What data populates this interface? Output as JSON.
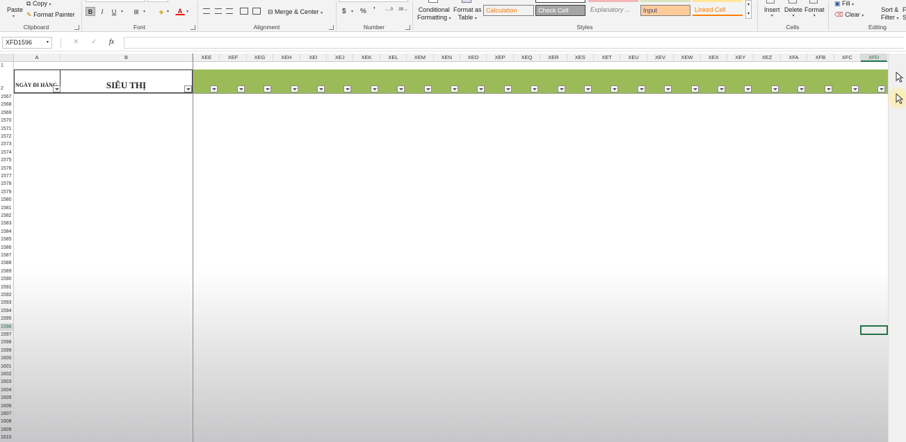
{
  "ribbon": {
    "clipboard": {
      "label": "Clipboard",
      "paste": "Paste",
      "copy": "Copy",
      "format_painter": "Format Painter"
    },
    "font": {
      "label": "Font",
      "bold": "B",
      "italic": "I",
      "underline": "U",
      "font_color": "A"
    },
    "alignment": {
      "label": "Alignment",
      "merge_center": "Merge & Center"
    },
    "number": {
      "label": "Number",
      "currency": "$",
      "percent": "%",
      "comma": "’",
      "inc_decimal": "←.0",
      "dec_decimal": ".00→"
    },
    "styles": {
      "label": "Styles",
      "conditional_formatting": [
        "Conditional",
        "Formatting"
      ],
      "format_as_table": [
        "Format as",
        "Table"
      ],
      "cells": [
        {
          "name": "Calculation",
          "bg": "#f2f2f2",
          "fg": "#fa7d00",
          "border": "#7f7f7f"
        },
        {
          "name": "Check Cell",
          "bg": "#a5a5a5",
          "fg": "#ffffff",
          "border": "#3f3f3f"
        },
        {
          "name": "Explanatory ...",
          "bg": "transparent",
          "fg": "#7f7f7f",
          "border": "transparent"
        },
        {
          "name": "Input",
          "bg": "#ffcc99",
          "fg": "#3f3f76",
          "border": "#7f7f7f"
        },
        {
          "name": "Linked Cell",
          "bg": "transparent",
          "fg": "#fa7d00",
          "border": "transparent"
        }
      ]
    },
    "cells": {
      "label": "Cells",
      "insert": "Insert",
      "delete": "Delete",
      "format": "Format"
    },
    "editing": {
      "label": "Editing",
      "fill": "Fill",
      "clear": "Clear",
      "sort_filter": [
        "Sort &",
        "Filter"
      ],
      "find_partial": [
        "F",
        "Se"
      ]
    }
  },
  "formula_bar": {
    "name_box": "XFD1596",
    "cancel": "✕",
    "enter": "✓",
    "fx": "fx",
    "value": ""
  },
  "grid": {
    "left_columns": [
      "A",
      "B"
    ],
    "columns": [
      "XEE",
      "XEF",
      "XEG",
      "XEH",
      "XEI",
      "XEJ",
      "XEK",
      "XEL",
      "XEM",
      "XEN",
      "XEO",
      "XEP",
      "XEQ",
      "XER",
      "XES",
      "XET",
      "XEU",
      "XEV",
      "XEW",
      "XEX",
      "XEY",
      "XEZ",
      "XFA",
      "XFB",
      "XFC",
      "XFD"
    ],
    "selected_column": "XFD",
    "rows": [
      "1",
      "2",
      "1567",
      "1568",
      "1569",
      "1570",
      "1571",
      "1572",
      "1573",
      "1574",
      "1575",
      "1576",
      "1577",
      "1578",
      "1579",
      "1580",
      "1581",
      "1582",
      "1583",
      "1584",
      "1585",
      "1586",
      "1587",
      "1588",
      "1589",
      "1590",
      "1591",
      "1592",
      "1593",
      "1594",
      "1595",
      "1596",
      "1597",
      "1598",
      "1599",
      "1600",
      "1601",
      "1602",
      "1603",
      "1604",
      "1605",
      "1606",
      "1607",
      "1608",
      "1609",
      "1610"
    ],
    "selected_row": "1596",
    "header_a": "NGÀY ĐI HÀNG",
    "header_b": "SIÊU THỊ",
    "header_band_color": "#9bbb59",
    "active_cell": "XFD1596"
  }
}
